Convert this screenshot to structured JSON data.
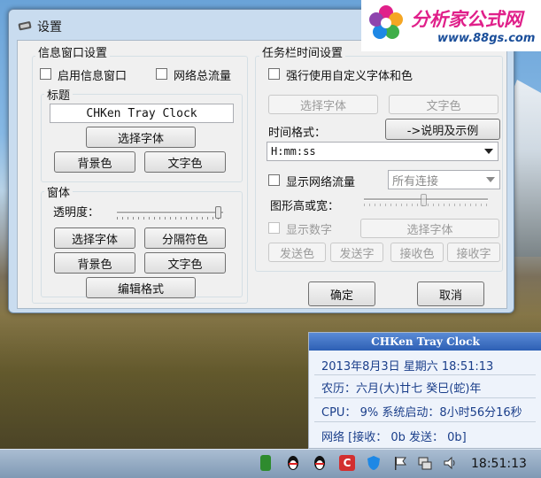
{
  "window": {
    "title": "设置"
  },
  "info_group": {
    "title": "信息窗口设置",
    "enable_info_window": "启用信息窗口",
    "network_total_traffic": "网络总流量",
    "heading_section": {
      "title": "标题",
      "title_value": "CHKen Tray Clock",
      "select_font": "选择字体",
      "bg_color": "背景色",
      "text_color": "文字色"
    },
    "window_section": {
      "title": "窗体",
      "transparency_label": "透明度：",
      "transparency_level": 0.95,
      "select_font": "选择字体",
      "separator": "分隔符色",
      "bg_color": "背景色",
      "text_color": "文字色",
      "edit_format": "编辑格式"
    }
  },
  "taskbar_group": {
    "title": "任务栏时间设置",
    "force_custom_font": "强行使用自定义字体和色",
    "select_font": "选择字体",
    "text_color": "文字色",
    "time_format_label": "时间格式：",
    "help_button": "->说明及示例",
    "time_format_value": "H:mm:ss",
    "show_net_traffic": "显示网络流量",
    "connection_select": "所有连接",
    "graph_size_label": "图形高或宽：",
    "graph_size_level": 0.48,
    "show_digits": "显示数字",
    "select_font_2": "选择字体",
    "send_color": "发送色",
    "send_text": "发送字",
    "recv_color": "接收色",
    "recv_text": "接收字"
  },
  "dialog_buttons": {
    "ok": "确定",
    "cancel": "取消"
  },
  "watermark": {
    "main": "分析家公式网",
    "url": "www.88gs.com"
  },
  "clock_popup": {
    "title": "CHKen Tray Clock",
    "date_line": "2013年8月3日 星期六   18:51:13",
    "lunar_line": "农历：六月(大)廿七   癸巳(蛇)年",
    "cpu_line": "CPU： 9%   系统启动：8小时56分16秒",
    "net_line": "网络  [接收：     0b  发送：     0b]"
  },
  "taskbar": {
    "time": "18:51:13"
  },
  "colors": {
    "accent": "#2d5fb4",
    "logo_pink": "#e0208a",
    "logo_blue": "#1a4e9a"
  }
}
